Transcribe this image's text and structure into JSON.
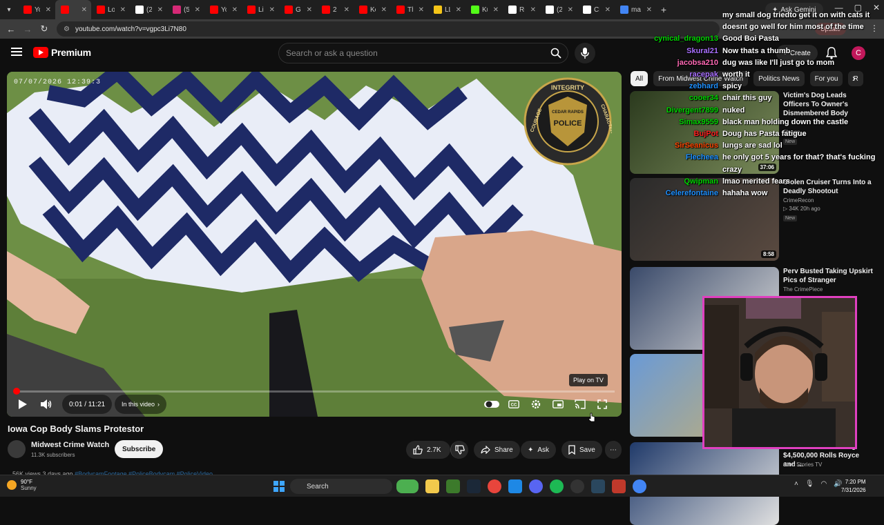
{
  "browser": {
    "tabs": [
      {
        "label": "You",
        "color": "#ff0000"
      },
      {
        "label": "",
        "color": "#ff0000",
        "active": true
      },
      {
        "label": "Lof",
        "color": "#ff0000"
      },
      {
        "label": "(21",
        "color": "#ffffff"
      },
      {
        "label": "(5)",
        "color": "#d62976"
      },
      {
        "label": "You",
        "color": "#ff0000"
      },
      {
        "label": "Litt",
        "color": "#ff0000"
      },
      {
        "label": "Girl",
        "color": "#ff0000"
      },
      {
        "label": "2 m",
        "color": "#ff0000"
      },
      {
        "label": "Koa",
        "color": "#ff0000"
      },
      {
        "label": "The",
        "color": "#ff0000"
      },
      {
        "label": "LLA",
        "color": "#f5c518"
      },
      {
        "label": "Kul",
        "color": "#53fc18"
      },
      {
        "label": "R-",
        "color": "#ffffff"
      },
      {
        "label": "(21",
        "color": "#ffffff"
      },
      {
        "label": "Chi",
        "color": "#ffffff"
      },
      {
        "label": "man kil",
        "color": "#4285f4"
      }
    ],
    "ask_gemini": "Ask Gemini",
    "url": "youtube.com/watch?v=vgpc3Li7N80",
    "update_label": "Update"
  },
  "header": {
    "logo_text": "Premium",
    "search_placeholder": "Search or ask a question",
    "create_label": "Create",
    "avatar_letter": "C"
  },
  "player": {
    "overlay_timestamp": "07/07/2026 12:39:3",
    "badge_top": "INTEGRITY",
    "badge_city": "CEDAR RAPIDS",
    "badge_word": "POLICE",
    "badge_left": "COURAGE",
    "badge_right": "CHARACTER",
    "time_display": "0:01 / 11:21",
    "chapter_label": "In this video",
    "play_on_tv": "Play on TV",
    "progress_fraction": 0.0015
  },
  "video": {
    "title": "Iowa Cop Body Slams Protestor",
    "channel": "Midwest Crime Watch",
    "subscribers": "11.3K subscribers",
    "subscribe_label": "Subscribe",
    "likes": "2.7K",
    "share_label": "Share",
    "ask_label": "Ask",
    "save_label": "Save",
    "views_line": "56K views  3 days ago",
    "tags_line": "#BodycamFootage #PoliceBodycam #PoliceVideo"
  },
  "sidebar": {
    "chips": [
      "All",
      "From Midwest Crime Watch",
      "Politics News",
      "For you",
      "R"
    ],
    "recommendations": [
      {
        "title": "Victim's Dog Leads Officers To Owner's Dismembered Body",
        "channel": "",
        "meta": "5h ago",
        "new": "New",
        "duration": "37:06"
      },
      {
        "title": "Stolen Cruiser Turns Into a Deadly Shootout",
        "channel": "CrimeRecon",
        "meta": "▷ 34K  20h ago",
        "new": "New",
        "duration": "8:58"
      },
      {
        "title": "Perv Busted Taking Upskirt Pics of Stranger",
        "channel": "The CrimePiece",
        "meta": "",
        "new": "",
        "duration": ""
      },
      {
        "title": "ed",
        "channel": "",
        "meta": "",
        "new": "",
        "duration": ""
      },
      {
        "title": "Minutes After Stealing $4,500,000 Rolls Royce and ...",
        "channel": "Cam Stories TV",
        "meta": "",
        "new": "",
        "duration": ""
      }
    ]
  },
  "chat": [
    {
      "user": "",
      "color": "#ffffff",
      "msg": "my small dog triedto get it on with cats it"
    },
    {
      "user": "",
      "color": "#ffffff",
      "msg": "doesnt go well for him most of the time"
    },
    {
      "user": "cynical_dragon13",
      "color": "#00d400",
      "msg": "Good Boi Pasta"
    },
    {
      "user": "Skural21",
      "color": "#a970ff",
      "msg": "Now thats a thumb"
    },
    {
      "user": "jacobsa210",
      "color": "#ff69b4",
      "msg": "dug was like I'll just go to mom"
    },
    {
      "user": "racepak",
      "color": "#a970ff",
      "msg": "worth it"
    },
    {
      "user": "zebhard",
      "color": "#1e90ff",
      "msg": "spicy"
    },
    {
      "user": "cooer34",
      "color": "#00d400",
      "msg": "chair this guy"
    },
    {
      "user": "Divergent7899",
      "color": "#00d400",
      "msg": "nuked"
    },
    {
      "user": "Simax9559",
      "color": "#00d400",
      "msg": "black man holding down the castle"
    },
    {
      "user": "BujPot",
      "color": "#ff2020",
      "msg": "Doug has Pasta fatigue"
    },
    {
      "user": "SirSeanicus",
      "color": "#ff4500",
      "msg": "lungs are sad lol"
    },
    {
      "user": "Flecheea",
      "color": "#1e90ff",
      "msg": "he only got 5 years for that? that's fucking"
    },
    {
      "user": "",
      "color": "#ffffff",
      "msg": "crazy"
    },
    {
      "user": "Qwipman",
      "color": "#00d400",
      "msg": "lmao merited fears"
    },
    {
      "user": "Celerefontaine",
      "color": "#1e90ff",
      "msg": "hahaha wow"
    }
  ],
  "taskbar": {
    "temp": "90°F",
    "condition": "Sunny",
    "search_label": "Search",
    "time": "7:20 PM",
    "date": "7/31/2026"
  },
  "colors": {
    "accent": "#ff0000",
    "webcam_border": "#e040c0"
  }
}
